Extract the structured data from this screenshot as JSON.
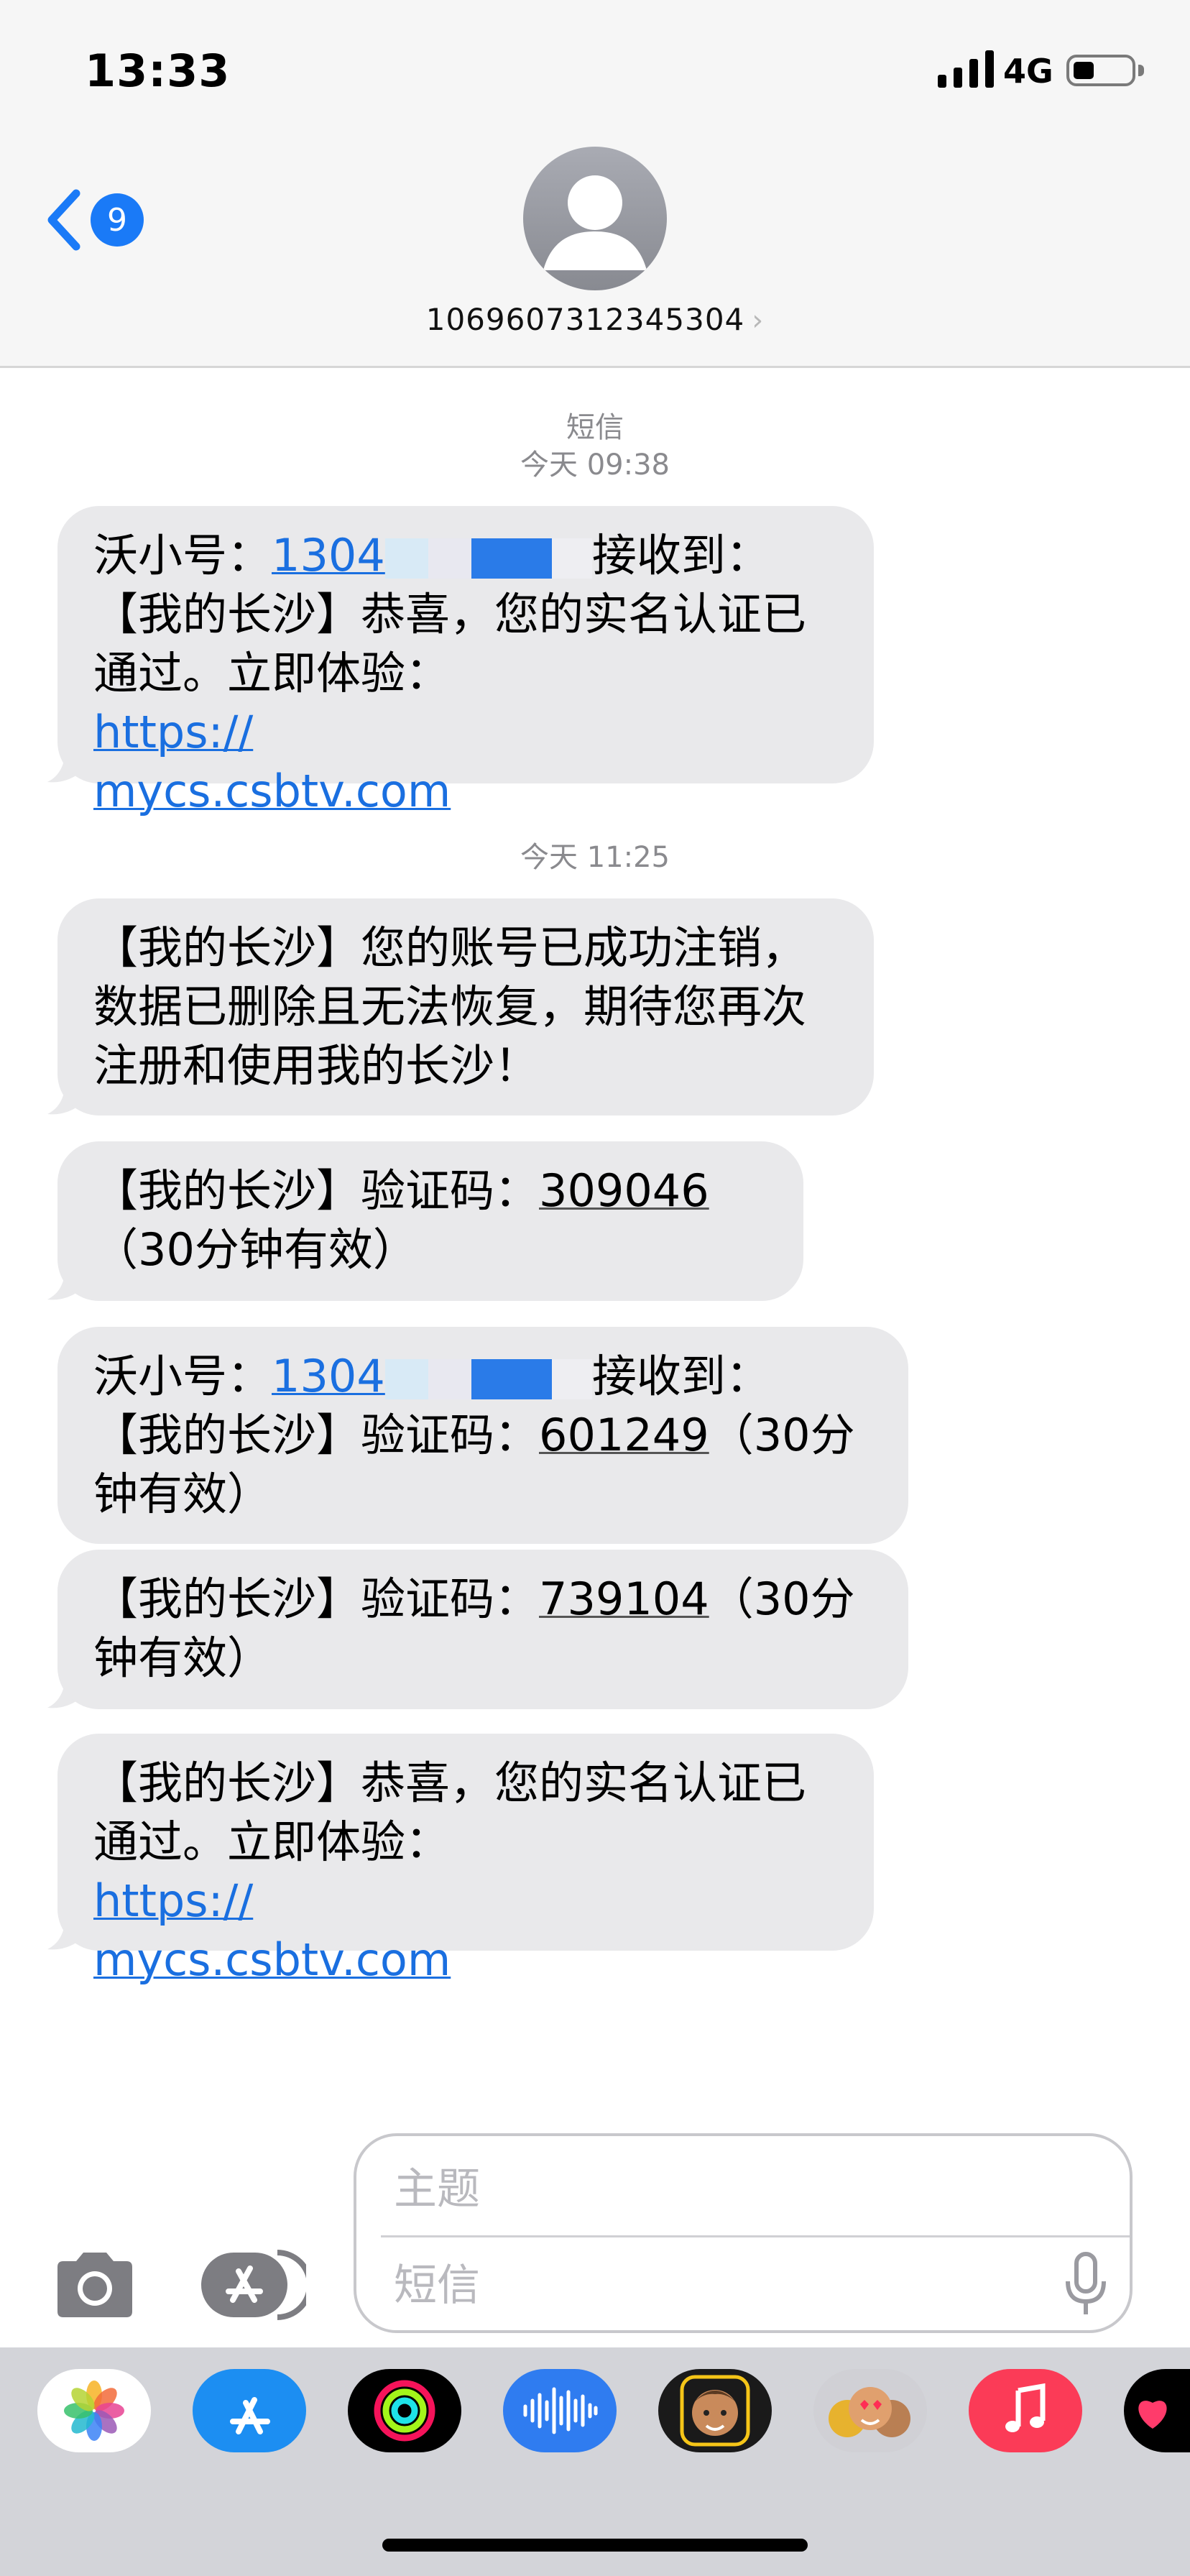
{
  "status_bar": {
    "time": "13:33",
    "network": "4G"
  },
  "header": {
    "back_badge": "9",
    "contact_number": "1069607312345304"
  },
  "conversation": {
    "service_label": "短信",
    "first_timestamp": "今天 09:38",
    "second_timestamp": "今天 11:25"
  },
  "messages": [
    {
      "prefix": "沃小号：",
      "number_visible": "1304",
      "text_after_number": "接收到：",
      "text": "【我的长沙】恭喜，您的实名认证已通过。立即体验：",
      "link": "https://mycs.csbtv.com",
      "link_line1": "https://",
      "link_line2": "mycs.csbtv.com"
    },
    {
      "text": "【我的长沙】您的账号已成功注销，数据已删除且无法恢复，期待您再次注册和使用我的长沙！"
    },
    {
      "text": "【我的长沙】验证码：",
      "code": "309046",
      "suffix": "（30分钟有效）"
    },
    {
      "prefix": "沃小号：",
      "number_visible": "1304",
      "text_after_number": "接收到：",
      "text": "【我的长沙】验证码：",
      "code": "601249",
      "suffix": "（30分钟有效）"
    },
    {
      "text": "【我的长沙】验证码：",
      "code": "739104",
      "suffix": "（30分钟有效）"
    },
    {
      "text": "【我的长沙】恭喜，您的实名认证已通过。立即体验：",
      "link_line1": "https://",
      "link_line2": "mycs.csbtv.com"
    }
  ],
  "compose": {
    "subject_placeholder": "主题",
    "message_placeholder": "短信"
  },
  "icons": {
    "back": "chevron-left-icon",
    "camera": "camera-icon",
    "apps": "app-store-icon",
    "mic": "microphone-icon"
  },
  "colors": {
    "accent": "#1a7af7",
    "bubble": "#e9e9eb",
    "link": "#1a6fe0",
    "drawer": "#d3d4d9"
  }
}
